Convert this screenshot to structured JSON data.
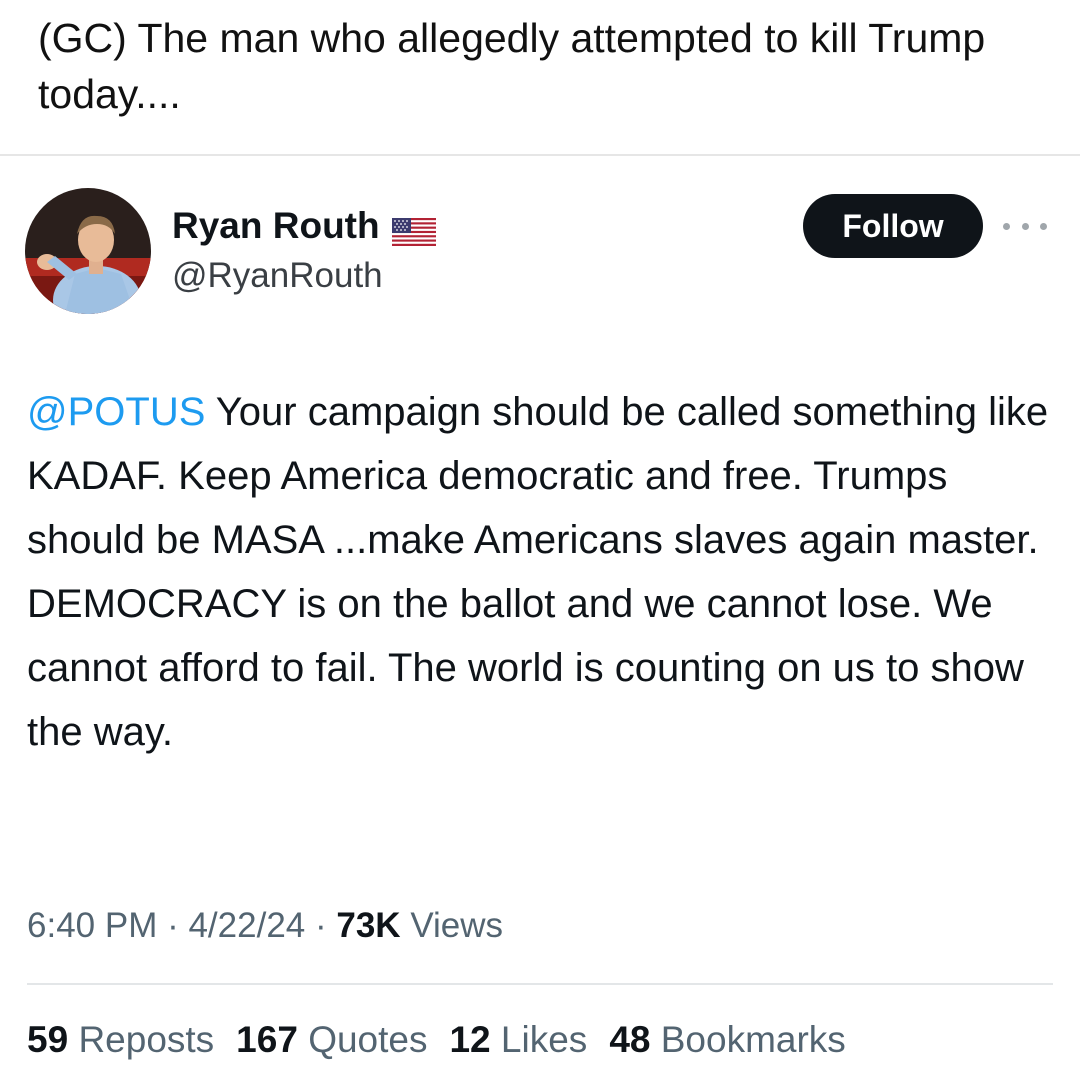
{
  "post": {
    "caption": "(GC) The man who allegedly attempted to kill Trump today...."
  },
  "tweet": {
    "author_name": "Ryan Routh",
    "handle": "@RyanRouth",
    "follow_label": "Follow",
    "mention": "@POTUS",
    "text": " Your campaign should be called something like KADAF. Keep America democratic and free. Trumps should be MASA ...make Americans slaves again master. DEMOCRACY is on the ballot and we cannot lose. We cannot afford to fail. The world is counting on us to show the way.",
    "time": "6:40 PM",
    "date": "4/22/24",
    "views_count": "73K",
    "views_label": "Views",
    "separator": " · ",
    "stats": {
      "reposts_count": "59",
      "reposts_label": "Reposts",
      "quotes_count": "167",
      "quotes_label": "Quotes",
      "likes_count": "12",
      "likes_label": "Likes",
      "bookmarks_count": "48",
      "bookmarks_label": "Bookmarks"
    }
  },
  "icons": {
    "flag": "us-flag-icon",
    "more": "more-options-icon"
  },
  "colors": {
    "mention": "#1d9bf0",
    "follow_button_bg": "#0f1419",
    "secondary_text": "#536471"
  }
}
